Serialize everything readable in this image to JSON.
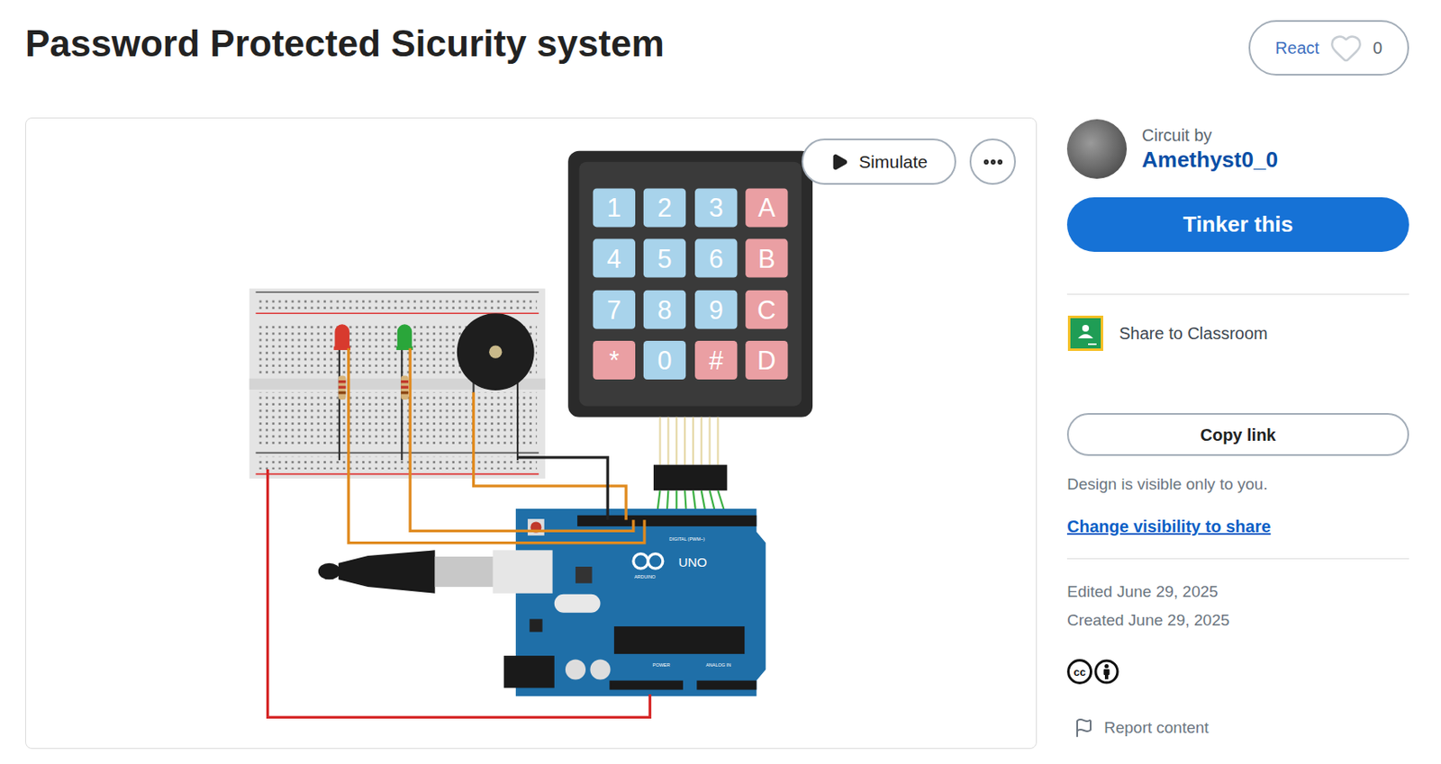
{
  "page": {
    "title": "Password Protected Sicurity system"
  },
  "react_button": {
    "label": "React",
    "count": "0"
  },
  "canvas": {
    "simulate_button": "Simulate",
    "keypad": {
      "keys": [
        {
          "label": "1",
          "color": "#a8d3eb"
        },
        {
          "label": "2",
          "color": "#a8d3eb"
        },
        {
          "label": "3",
          "color": "#a8d3eb"
        },
        {
          "label": "A",
          "color": "#ea9fa3"
        },
        {
          "label": "4",
          "color": "#a8d3eb"
        },
        {
          "label": "5",
          "color": "#a8d3eb"
        },
        {
          "label": "6",
          "color": "#a8d3eb"
        },
        {
          "label": "B",
          "color": "#ea9fa3"
        },
        {
          "label": "7",
          "color": "#a8d3eb"
        },
        {
          "label": "8",
          "color": "#a8d3eb"
        },
        {
          "label": "9",
          "color": "#a8d3eb"
        },
        {
          "label": "C",
          "color": "#ea9fa3"
        },
        {
          "label": "*",
          "color": "#ea9fa3"
        },
        {
          "label": "0",
          "color": "#a8d3eb"
        },
        {
          "label": "#",
          "color": "#ea9fa3"
        },
        {
          "label": "D",
          "color": "#ea9fa3"
        }
      ]
    },
    "leds": [
      {
        "color": "#d83a2e"
      },
      {
        "color": "#2aa63a"
      }
    ],
    "arduino": {
      "model": "UNO",
      "brand": "ARDUINO",
      "digital": "DIGITAL (PWM~)",
      "power": "POWER",
      "analog": "ANALOG IN"
    }
  },
  "sidebar": {
    "author_caption": "Circuit by",
    "author": "Amethyst0_0",
    "tinker_button": "Tinker this",
    "share_classroom": "Share to Classroom",
    "copy_link": "Copy link",
    "visibility_note": "Design is visible only to you.",
    "visibility_link": "Change visibility to share",
    "edited": "Edited June 29, 2025",
    "created": "Created June 29, 2025",
    "license_mark": "cc",
    "report": "Report content"
  }
}
